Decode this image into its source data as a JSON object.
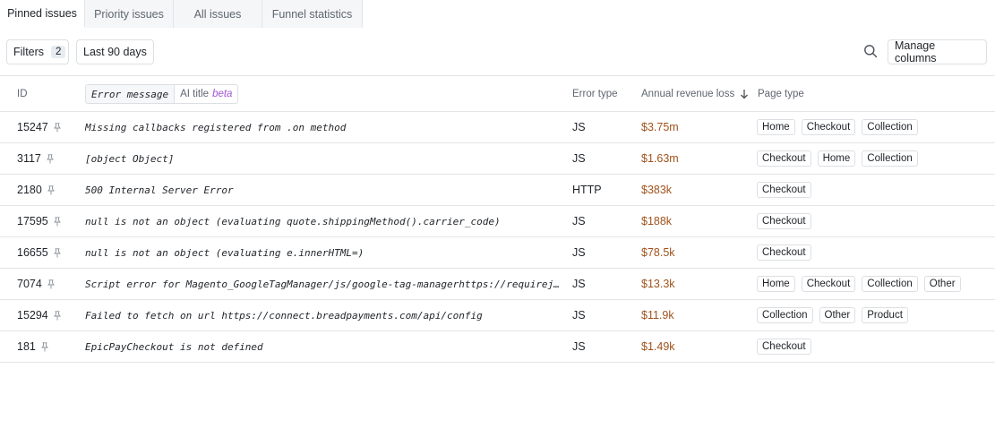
{
  "tabs": [
    {
      "label": "Pinned issues",
      "active": true
    },
    {
      "label": "Priority issues",
      "active": false
    },
    {
      "label": "All issues",
      "active": false
    },
    {
      "label": "Funnel statistics",
      "active": false
    }
  ],
  "toolbar": {
    "filters_label": "Filters",
    "filters_count": "2",
    "date_label": "Last 90 days",
    "manage_columns_label": "Manage columns"
  },
  "table": {
    "headers": {
      "id": "ID",
      "error_message": "Error message",
      "ai_title": "AI title",
      "beta": "beta",
      "error_type": "Error type",
      "revenue": "Annual revenue loss",
      "page_type": "Page type"
    },
    "rows": [
      {
        "id": "15247",
        "message": "Missing callbacks registered from .on method",
        "type": "JS",
        "revenue": "$3.75m",
        "pages": [
          "Home",
          "Checkout",
          "Collection"
        ]
      },
      {
        "id": "3117",
        "message": "[object Object]",
        "type": "JS",
        "revenue": "$1.63m",
        "pages": [
          "Checkout",
          "Home",
          "Collection"
        ]
      },
      {
        "id": "2180",
        "message": "500 Internal Server Error",
        "type": "HTTP",
        "revenue": "$383k",
        "pages": [
          "Checkout"
        ]
      },
      {
        "id": "17595",
        "message": "null is not an object (evaluating quote.shippingMethod().carrier_code)",
        "type": "JS",
        "revenue": "$188k",
        "pages": [
          "Checkout"
        ]
      },
      {
        "id": "16655",
        "message": "null is not an object (evaluating e.innerHTML=)",
        "type": "JS",
        "revenue": "$78.5k",
        "pages": [
          "Checkout"
        ]
      },
      {
        "id": "7074",
        "message": "Script error for Magento_GoogleTagManager/js/google-tag-managerhttps://requirejs.org/docs/errors.html#scripterror",
        "type": "JS",
        "revenue": "$13.3k",
        "pages": [
          "Home",
          "Checkout",
          "Collection",
          "Other"
        ]
      },
      {
        "id": "15294",
        "message": "Failed to fetch on url https://connect.breadpayments.com/api/config",
        "type": "JS",
        "revenue": "$11.9k",
        "pages": [
          "Collection",
          "Other",
          "Product"
        ]
      },
      {
        "id": "181",
        "message": "EpicPayCheckout is not defined",
        "type": "JS",
        "revenue": "$1.49k",
        "pages": [
          "Checkout"
        ]
      }
    ]
  },
  "colors": {
    "revenue": "#a0521c",
    "beta": "#a155d6",
    "border": "#e3e5e8"
  }
}
